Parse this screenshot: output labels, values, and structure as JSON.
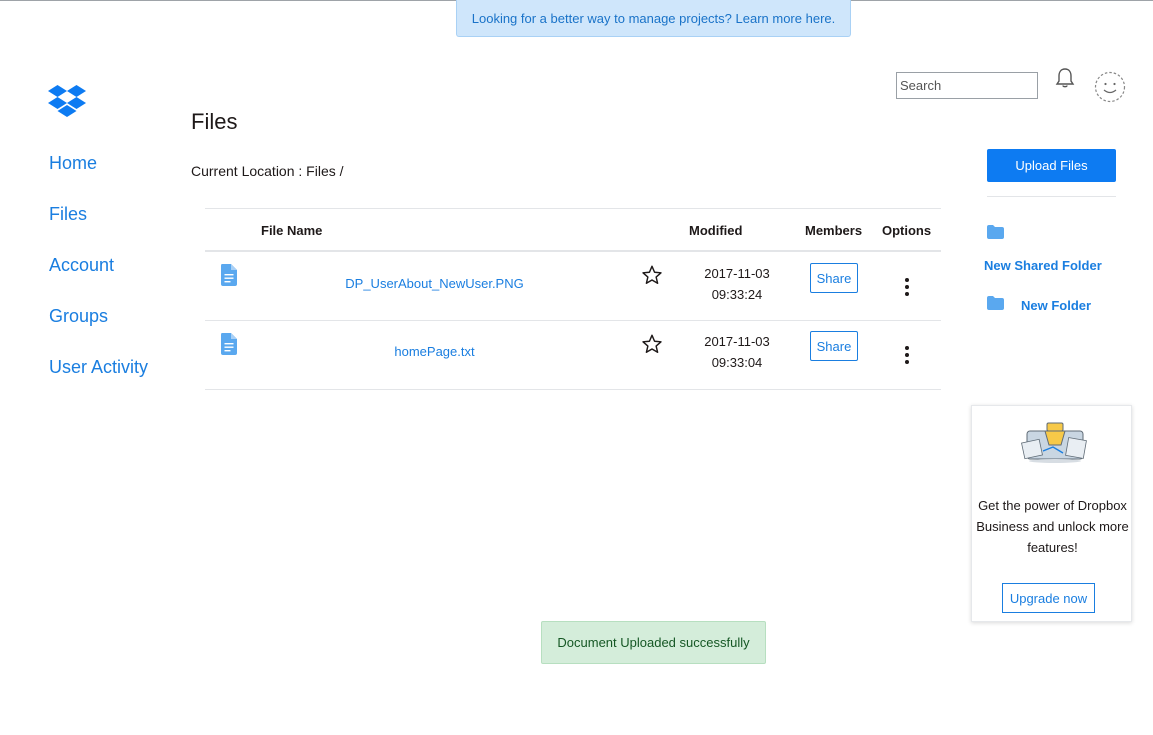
{
  "banner": {
    "text": "Looking for a better way to manage projects? Learn more here."
  },
  "sidebar": {
    "items": [
      {
        "label": "Home"
      },
      {
        "label": "Files"
      },
      {
        "label": "Account"
      },
      {
        "label": "Groups"
      },
      {
        "label": "User Activity"
      }
    ]
  },
  "header": {
    "search_placeholder": "Search",
    "notifications_icon": "bell-icon",
    "avatar_icon": "avatar-smiley-icon"
  },
  "main": {
    "title": "Files",
    "location": "Current Location : Files /",
    "table": {
      "columns": [
        "File Name",
        "Modified",
        "Members",
        "Options"
      ],
      "rows": [
        {
          "name": "DP_UserAbout_NewUser.PNG",
          "date": "2017-11-03",
          "time": "09:33:24",
          "share": "Share"
        },
        {
          "name": "homePage.txt",
          "date": "2017-11-03",
          "time": "09:33:04",
          "share": "Share"
        }
      ]
    }
  },
  "rightpanel": {
    "upload_label": "Upload Files",
    "new_shared_folder": "New Shared Folder",
    "new_folder": "New Folder"
  },
  "promo": {
    "text": "Get the power of Dropbox Business and unlock more features!",
    "button": "Upgrade now"
  },
  "toast": {
    "text": "Document Uploaded successfully"
  },
  "colors": {
    "accent": "#0d7bf2",
    "link": "#1a7ee0",
    "banner_bg": "#cfe6fb",
    "toast_bg": "#d4edda"
  }
}
